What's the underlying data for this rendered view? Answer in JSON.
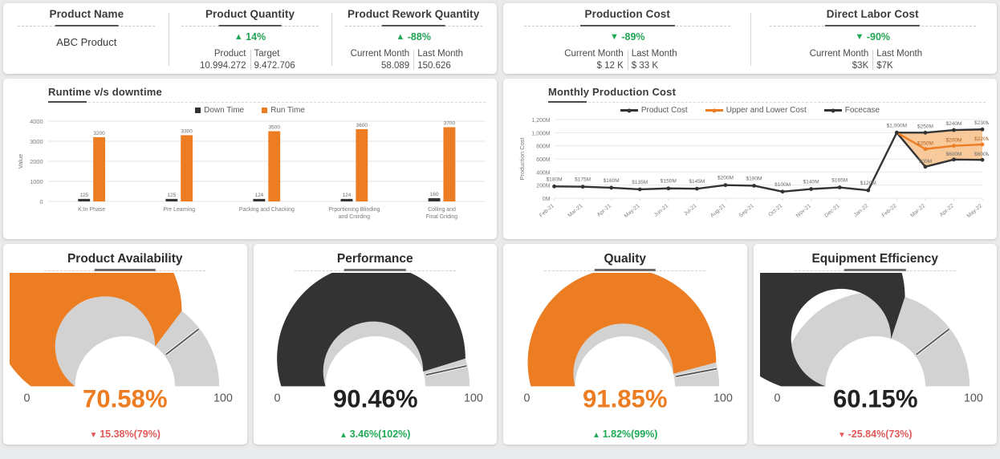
{
  "kpi_left": [
    {
      "title": "Product Name",
      "type": "plain",
      "value": "ABC Product"
    },
    {
      "title": "Product Quantity",
      "type": "delta",
      "arrow": "up",
      "delta": "14%",
      "sub": [
        {
          "label": "Product",
          "value": "10.994.272"
        },
        {
          "label": "Target",
          "value": "9.472.706"
        }
      ]
    },
    {
      "title": "Product Rework Quantity",
      "type": "delta",
      "arrow": "up",
      "delta": "-88%",
      "sub": [
        {
          "label": "Current Month",
          "value": "58.089"
        },
        {
          "label": "Last Month",
          "value": "150.626"
        }
      ]
    }
  ],
  "kpi_right": [
    {
      "title": "Production Cost",
      "type": "delta",
      "arrow": "down",
      "delta": "-89%",
      "sub": [
        {
          "label": "Current Month",
          "value": "$ 12 K"
        },
        {
          "label": "Last Month",
          "value": "$ 33 K"
        }
      ]
    },
    {
      "title": "Direct Labor Cost",
      "type": "delta",
      "arrow": "down",
      "delta": "-90%",
      "sub": [
        {
          "label": "Current Month",
          "value": "$3K"
        },
        {
          "label": "Last Month",
          "value": "$7K"
        }
      ]
    }
  ],
  "colors": {
    "orange": "#ED7D22",
    "dark": "#333333",
    "gray": "#D2D2D2",
    "green": "#1FAA55",
    "red": "#E05A5A",
    "band": "#F6C08A"
  },
  "chart_data": [
    {
      "type": "bar",
      "title": "Runtime v/s downtime",
      "xlabel": "",
      "ylabel": "Value",
      "ylim": [
        0,
        4000
      ],
      "yticks": [
        "0",
        "1000",
        "2000",
        "3000",
        "4000"
      ],
      "grid": true,
      "legend_position": "top",
      "categories": [
        "K:In Phase",
        "Pre Learning",
        "Packing and Chacking",
        "Prportioning Blinding and Cnirding",
        "Colling and Final Griding"
      ],
      "series": [
        {
          "name": "Down Time",
          "color": "#333333",
          "values": [
            125,
            125,
            124,
            124,
            160
          ]
        },
        {
          "name": "Run Time",
          "color": "#ED7D22",
          "values": [
            3200,
            3300,
            3500,
            3600,
            3700
          ]
        }
      ]
    },
    {
      "type": "line",
      "title": "Monthly Production Cost",
      "xlabel": "",
      "ylabel": "Production Cost",
      "ylim": [
        0,
        1200
      ],
      "yticks": [
        "0M",
        "200M",
        "400M",
        "600M",
        "800M",
        "1,000M",
        "1,200M"
      ],
      "grid": true,
      "legend_position": "top",
      "x": [
        "Feb-21",
        "Mar-21",
        "Apr-21",
        "May-21",
        "Jun-21",
        "Jul-21",
        "Aug-21",
        "Sep-21",
        "Oct-21",
        "Nov-21",
        "Dec-21",
        "Jan-22",
        "Feb-22",
        "Mar-22",
        "Apr-22",
        "May-22"
      ],
      "series": [
        {
          "name": "Product Cost",
          "color": "#333333",
          "values": [
            180,
            175,
            160,
            135,
            150,
            145,
            200,
            190,
            100,
            140,
            165,
            120,
            1000,
            null,
            null,
            null
          ],
          "labels": [
            "$180M",
            "$175M",
            "$160M",
            "$135M",
            "$150M",
            "$145M",
            "$200M",
            "$190M",
            "$100M",
            "$140M",
            "$165M",
            "$120M",
            "$1,000M",
            "",
            "",
            ""
          ]
        },
        {
          "name": "Upper and Lower Cost",
          "color": "#ED7D22",
          "values": [
            null,
            null,
            null,
            null,
            null,
            null,
            null,
            null,
            null,
            null,
            null,
            null,
            1000,
            750,
            800,
            820
          ],
          "labels": [
            "",
            "",
            "",
            "",
            "",
            "",
            "",
            "",
            "",
            "",
            "",
            "",
            "",
            "$250M",
            "$200M",
            "$220M"
          ]
        },
        {
          "name": "Focecase",
          "color": "#333333",
          "upper": [
            null,
            null,
            null,
            null,
            null,
            null,
            null,
            null,
            null,
            null,
            null,
            null,
            1000,
            1000,
            1040,
            1050
          ],
          "lower": [
            null,
            null,
            null,
            null,
            null,
            null,
            null,
            null,
            null,
            null,
            null,
            null,
            1000,
            480,
            590,
            585
          ],
          "upper_labels": [
            "",
            "",
            "",
            "",
            "",
            "",
            "",
            "",
            "",
            "",
            "",
            "",
            "",
            "$250M",
            "$240M",
            "$230M"
          ],
          "lower_labels": [
            "",
            "",
            "",
            "",
            "",
            "",
            "",
            "",
            "",
            "",
            "",
            "",
            "",
            "500M",
            "$600M",
            "$600M"
          ]
        }
      ],
      "annotations": {
        "band_fill": "#F6C08A"
      }
    },
    {
      "type": "gauge",
      "title": "Product Availability",
      "value": 70.58,
      "value_label": "70.58%",
      "min_label": "0",
      "max_label": "100",
      "fill_color": "#ED7D22",
      "value_color": "#ED7D22",
      "needle": 79,
      "delta": "15.38%(79%)",
      "delta_dir": "down"
    },
    {
      "type": "gauge",
      "title": "Performance",
      "value": 90.46,
      "value_label": "90.46%",
      "min_label": "0",
      "max_label": "100",
      "fill_color": "#333333",
      "value_color": "#222222",
      "needle": 93,
      "delta": "3.46%(102%)",
      "delta_dir": "up"
    },
    {
      "type": "gauge",
      "title": "Quality",
      "value": 91.85,
      "value_label": "91.85%",
      "min_label": "0",
      "max_label": "100",
      "fill_color": "#ED7D22",
      "value_color": "#ED7D22",
      "needle": 94,
      "delta": "1.82%(99%)",
      "delta_dir": "up"
    },
    {
      "type": "gauge",
      "title": "Equipment Efficiency",
      "value": 60.15,
      "value_label": "60.15%",
      "min_label": "0",
      "max_label": "100",
      "fill_color": "#333333",
      "value_color": "#222222",
      "needle": 79,
      "delta": "-25.84%(73%)",
      "delta_dir": "down"
    }
  ]
}
